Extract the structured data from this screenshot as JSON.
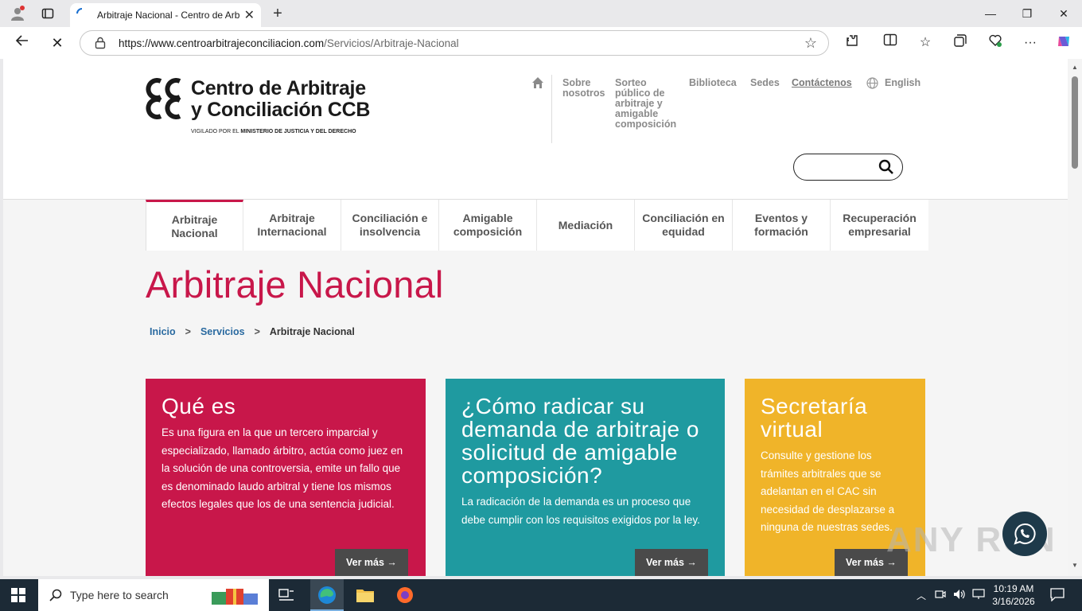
{
  "browser": {
    "tab_title": "Arbitraje Nacional - Centro de Arb",
    "url_host": "https://www.centroarbitrajeconciliacion.com",
    "url_path": "/Servicios/Arbitraje-Nacional"
  },
  "site": {
    "logo_line1": "Centro de Arbitraje",
    "logo_line2": "y Conciliación CCB",
    "logo_sub_prefix": "VIGILADO POR EL ",
    "logo_sub_bold": "MINISTERIO DE JUSTICIA Y DEL DERECHO",
    "topnav": {
      "sobre": "Sobre nosotros",
      "sorteo": "Sorteo público de arbitraje y amigable composición",
      "biblioteca": "Biblioteca",
      "sedes": "Sedes",
      "contactenos": "Contáctenos",
      "english": "English"
    },
    "search_placeholder": ""
  },
  "mainnav": [
    {
      "label": "Arbitraje Nacional"
    },
    {
      "label": "Arbitraje Internacional"
    },
    {
      "label": "Conciliación e insolvencia"
    },
    {
      "label": "Amigable composición"
    },
    {
      "label": "Mediación"
    },
    {
      "label": "Conciliación en equidad"
    },
    {
      "label": "Eventos y formación"
    },
    {
      "label": "Recuperación empresarial"
    }
  ],
  "page": {
    "title": "Arbitraje Nacional",
    "breadcrumb": {
      "home": "Inicio",
      "section": "Servicios",
      "current": "Arbitraje Nacional"
    }
  },
  "cards": [
    {
      "title": "Qué es",
      "text": "Es una figura en la que un tercero imparcial y especializado, llamado árbitro, actúa como juez en la solución de una controversia, emite un fallo que es denominado laudo arbitral y tiene los mismos efectos legales que los de una sentencia judicial.",
      "button": "Ver más →",
      "color": "#c8174a"
    },
    {
      "title": "¿Cómo radicar su demanda de arbitraje o solicitud de amigable composición?",
      "text": "La radicación de la demanda es un proceso que debe cumplir con los requisitos exigidos por la ley.",
      "button": "Ver más →",
      "color": "#1f9aa0"
    },
    {
      "title": "Secretaría virtual",
      "text": "Consulte y gestione los trámites arbitrales que se adelantan en el CAC sin necesidad de desplazarse a ninguna de nuestras sedes.",
      "button": "Ver más →",
      "color": "#f0b429"
    }
  ],
  "taskbar": {
    "search_text": "Type here to search",
    "time": "10:19 AM",
    "date": "3/16/2026"
  },
  "watermark": "ANY RUN"
}
